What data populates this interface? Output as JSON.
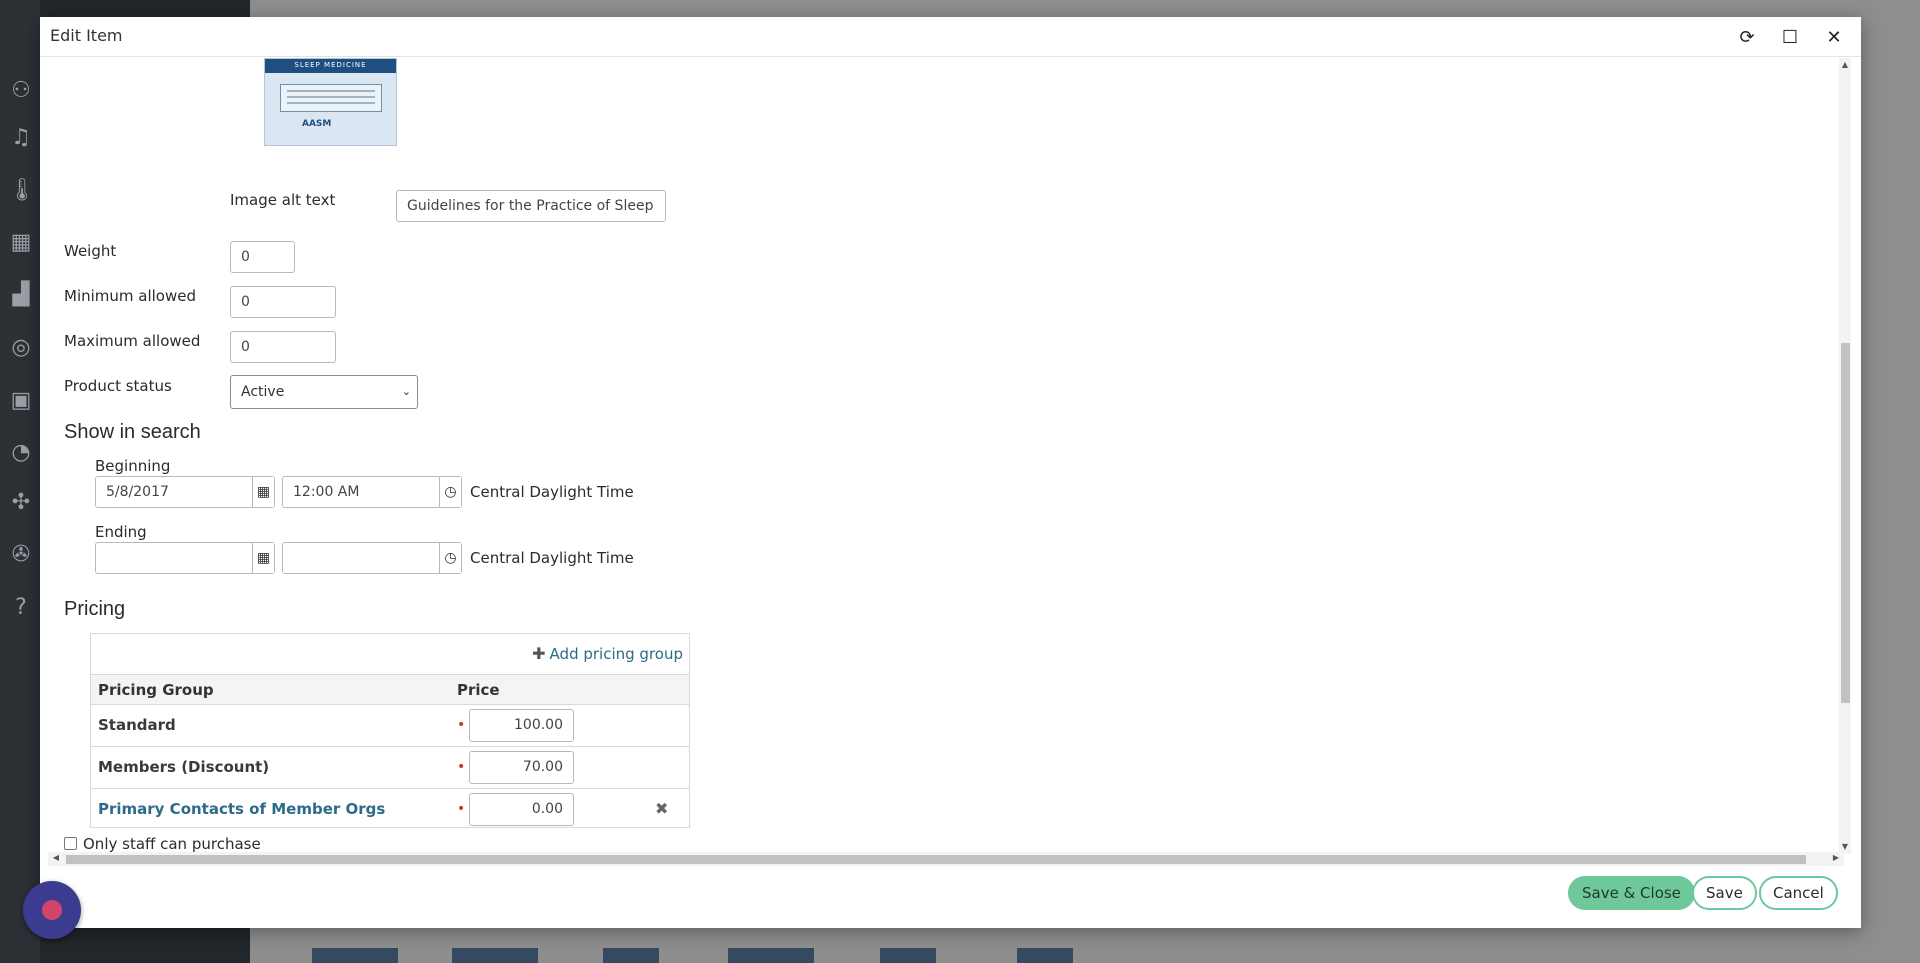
{
  "dialog": {
    "title": "Edit Item",
    "refresh_icon": "refresh-icon",
    "maximize_icon": "maximize-icon",
    "close_icon": "close-icon"
  },
  "image": {
    "alt_label": "Image alt text",
    "alt_value": "Guidelines for the Practice of Sleep",
    "thumb_banner": "SLEEP MEDICINE",
    "thumb_logo": "AASM"
  },
  "fields": {
    "weight": {
      "label": "Weight",
      "value": "0"
    },
    "min_allowed": {
      "label": "Minimum allowed",
      "value": "0"
    },
    "max_allowed": {
      "label": "Maximum allowed",
      "value": "0"
    },
    "product_status": {
      "label": "Product status",
      "value": "Active"
    }
  },
  "show_in_search": {
    "heading": "Show in search",
    "beginning": {
      "label": "Beginning",
      "date": "5/8/2017",
      "time": "12:00 AM",
      "tz": "Central Daylight Time"
    },
    "ending": {
      "label": "Ending",
      "date": "",
      "time": "",
      "tz": "Central Daylight Time"
    }
  },
  "pricing": {
    "heading": "Pricing",
    "add_label": "Add pricing group",
    "col_group": "Pricing Group",
    "col_price": "Price",
    "rows": [
      {
        "group": "Standard",
        "price": "100.00",
        "link": false
      },
      {
        "group": "Members (Discount)",
        "price": "70.00",
        "link": false
      },
      {
        "group": "Primary Contacts of Member Orgs",
        "price": "0.00",
        "link": true
      }
    ]
  },
  "staff_only": {
    "label": "Only staff can purchase",
    "checked": false
  },
  "footer": {
    "save_close": "Save & Close",
    "save": "Save",
    "cancel": "Cancel"
  },
  "colors": {
    "primary_button": "#6fc79c",
    "link": "#2d6b8a",
    "required": "#c0392b"
  }
}
